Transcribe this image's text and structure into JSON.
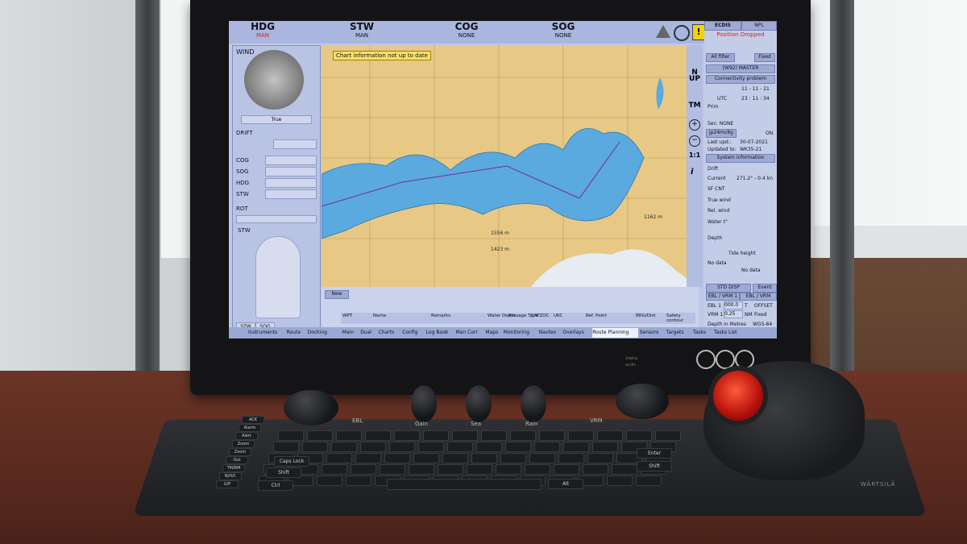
{
  "nav_header": [
    {
      "label": "HDG",
      "sub": "MAN",
      "sub_color": "#d22"
    },
    {
      "label": "STW",
      "sub": "MAN",
      "sub_color": "#111"
    },
    {
      "label": "COG",
      "sub": "NONE",
      "sub_color": "#111"
    },
    {
      "label": "SOG",
      "sub": "NONE",
      "sub_color": "#111"
    }
  ],
  "alert": {
    "chart_warning": "Chart information not up to date"
  },
  "left_panel": {
    "wind": "WIND",
    "true_btn": "True",
    "drift": "DRIFT",
    "rows": [
      "COG",
      "SOG",
      "HDG",
      "STW"
    ],
    "rot": "ROT",
    "stw": "STW",
    "bottom_btns": [
      "STW",
      "SOG"
    ]
  },
  "right_panel": {
    "tabs": [
      "ECDIS",
      "NPL"
    ],
    "position_dropped": "Position Dropped",
    "all_filter": "All filter",
    "fixed": "Fixed",
    "master": "(W92) MASTER",
    "connectivity": "Connectivity problem",
    "date": "11 - 11 - 21",
    "utc": "UTC",
    "time": "23 : 11 : 34",
    "prim": "Prim",
    "sec": "Sec: NONE",
    "chart_id": "jp24mc8g",
    "on": "ON",
    "last_upd": "Last upd.:",
    "last_upd_val": "30-07-2021",
    "updated_to": "Updated to:",
    "updated_to_val": "WK35-21",
    "system_info": "System information",
    "drift": "Drift",
    "current": "Current",
    "current_val": "271.2° - 0.4 kn",
    "sf_cnt": "SF CNT",
    "true_wind": "True wind",
    "rel_wind": "Rel. wind",
    "water_t": "Water t°",
    "depth": "Depth",
    "tide": "Tide height",
    "no_data_1": "No data",
    "no_data_2": "No data",
    "std_disp": "STD DISP",
    "event": "Event",
    "ebl_vrm_1": "EBL / VRM 1",
    "ebl_vrm_2": "EBL / VRM",
    "ebl1": "EBL 1",
    "ebl1_val": "000.0",
    "ebl1_unit": "T",
    "offset": "OFFSET",
    "vrm1": "VRM 1",
    "vrm1_val": "0.25",
    "vrm1_unit": "NM",
    "fixed2": "Fixed",
    "depth_metres": "Depth in Metres",
    "wgs": "WGS-84"
  },
  "chart": {
    "depth1": "1556 m",
    "depth2": "1423 m",
    "depth3": "1162 m"
  },
  "route_table": {
    "new_btn": "New",
    "headers": [
      "WPT",
      "Name",
      "Remarks",
      "Water Depth",
      "Passage Type",
      "CATZOC",
      "UKC",
      "Ref. Point",
      "BRG/Dist",
      "Safety contour"
    ]
  },
  "tabs": [
    "Instruments",
    "Route",
    "Docking",
    "Main",
    "Dual",
    "Charts",
    "Config",
    "Log Book",
    "Man Corr",
    "Maps",
    "Monitoring",
    "Navtex",
    "Overlays",
    "Route Planning",
    "Sensors",
    "Targets",
    "Tasks",
    "Tasks List"
  ],
  "keyboard": {
    "left_keys": [
      "ACK",
      "Alarm",
      "Alert",
      "Zoom",
      "Zoom",
      "Out",
      "TM/RM",
      "N/H/C",
      "U/P"
    ],
    "top_labels": [
      "EBL",
      "Gain",
      "Sea",
      "Rain",
      "VRM"
    ],
    "row_keys": [
      "Caps Lock",
      "Shift",
      "Ctrl",
      "Alt",
      "Enter",
      "Shift"
    ],
    "brand": "WÄRTSILÄ"
  },
  "monitor_leds": [
    "status",
    "ecdis"
  ]
}
